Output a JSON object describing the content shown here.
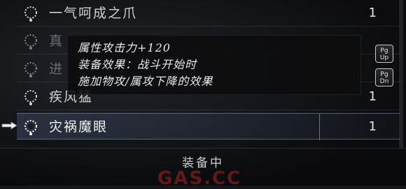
{
  "items": [
    {
      "name": "一气呵成之爪",
      "qty": "1",
      "state": "normal"
    },
    {
      "name": "真",
      "qty": "",
      "state": "dim"
    },
    {
      "name": "进",
      "qty": "",
      "state": "dim"
    },
    {
      "name": "疾风猛",
      "qty": "1",
      "state": "normal"
    },
    {
      "name": "灾祸魔眼",
      "qty": "1",
      "state": "selected"
    }
  ],
  "tooltip": {
    "line1": "属性攻击力+120",
    "line2": "装备效果：战斗开始时",
    "line3": "施加物攻/属攻下降的效果"
  },
  "keyhints": {
    "pgup_top": "Pg",
    "pgup_bottom": "Up",
    "pgdn_top": "Pg",
    "pgdn_bottom": "Dn"
  },
  "footer": {
    "status": "装备中",
    "watermark": "GAS.CC"
  }
}
